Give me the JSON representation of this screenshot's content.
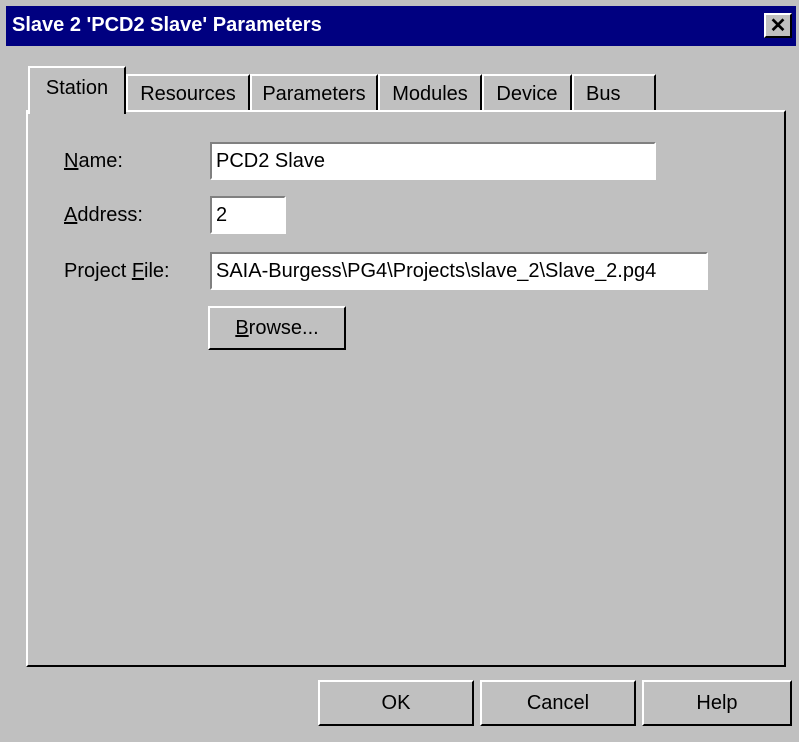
{
  "window": {
    "title": "Slave 2 'PCD2 Slave' Parameters",
    "close_glyph": "✕"
  },
  "tabs": [
    {
      "label": "Station",
      "active": true
    },
    {
      "label": "Resources"
    },
    {
      "label": "Parameters"
    },
    {
      "label": "Modules"
    },
    {
      "label": "Device"
    },
    {
      "label": "Bus"
    }
  ],
  "station": {
    "name_label": {
      "accel": "N",
      "rest": "ame:"
    },
    "name_value": "PCD2 Slave",
    "address_label": {
      "accel": "A",
      "rest": "ddress:"
    },
    "address_value": "2",
    "project_label": {
      "pre": "Project ",
      "accel": "F",
      "rest": "ile:"
    },
    "project_value": "SAIA-Burgess\\PG4\\Projects\\slave_2\\Slave_2.pg4",
    "browse": {
      "accel": "B",
      "rest": "rowse..."
    }
  },
  "buttons": {
    "ok": "OK",
    "cancel": "Cancel",
    "help": "Help"
  },
  "colors": {
    "titlebar": "#000080",
    "face": "#c0c0c0"
  }
}
